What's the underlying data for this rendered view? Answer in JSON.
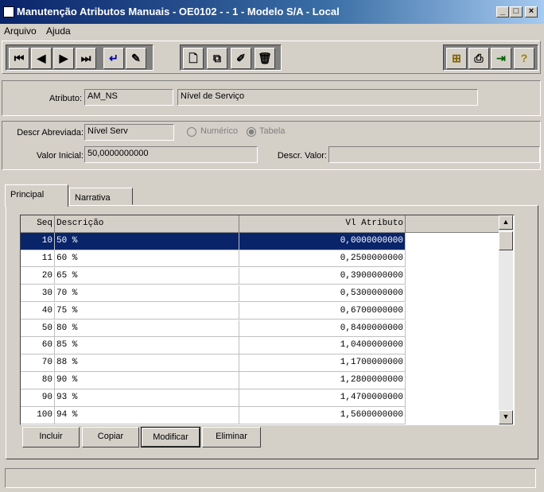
{
  "window": {
    "title": "Manutenção Atributos Manuais - OE0102 - - 1 - Modelo S/A - Local",
    "minimize": "_",
    "maximize": "□",
    "close": "×"
  },
  "menu": {
    "arquivo": "Arquivo",
    "ajuda": "Ajuda"
  },
  "toolbar": {
    "icons": [
      "first-record-icon",
      "prev-record-icon",
      "next-record-icon",
      "last-record-icon",
      "goto-icon",
      "search-icon",
      "new-icon",
      "copy-icon",
      "edit-icon",
      "delete-icon",
      "tree-icon",
      "print-icon",
      "exit-icon",
      "help-icon"
    ]
  },
  "header": {
    "atributo_label": "Atributo:",
    "atributo_code": "AM_NS",
    "atributo_desc": "Nível de Serviço"
  },
  "details": {
    "descr_abrev_label": "Descr Abreviada:",
    "descr_abrev_value": "Nível Serv",
    "numerico_label": "Numérico",
    "tabela_label": "Tabela",
    "selected_type": "Tabela",
    "valor_inicial_label": "Valor Inicial:",
    "valor_inicial_value": "50,0000000000",
    "descr_valor_label": "Descr. Valor:",
    "descr_valor_value": ""
  },
  "tabs": {
    "principal": "Principal",
    "narrativa": "Narrativa"
  },
  "grid": {
    "columns": {
      "seq": "Seq",
      "descricao": "Descrição",
      "vl_atributo": "Vl Atributo"
    },
    "rows": [
      {
        "seq": "10",
        "desc": "50 %",
        "vl": "0,0000000000"
      },
      {
        "seq": "11",
        "desc": "60 %",
        "vl": "0,2500000000"
      },
      {
        "seq": "20",
        "desc": "65 %",
        "vl": "0,3900000000"
      },
      {
        "seq": "30",
        "desc": "70 %",
        "vl": "0,5300000000"
      },
      {
        "seq": "40",
        "desc": "75 %",
        "vl": "0,6700000000"
      },
      {
        "seq": "50",
        "desc": "80 %",
        "vl": "0,8400000000"
      },
      {
        "seq": "60",
        "desc": "85 %",
        "vl": "1,0400000000"
      },
      {
        "seq": "70",
        "desc": "88 %",
        "vl": "1,1700000000"
      },
      {
        "seq": "80",
        "desc": "90 %",
        "vl": "1,2800000000"
      },
      {
        "seq": "90",
        "desc": "93 %",
        "vl": "1,4700000000"
      },
      {
        "seq": "100",
        "desc": "94 %",
        "vl": "1,5600000000"
      }
    ]
  },
  "buttons": {
    "incluir": "Incluir",
    "copiar": "Copiar",
    "modificar": "Modificar",
    "eliminar": "Eliminar"
  },
  "statusbar": {
    "text": ""
  }
}
